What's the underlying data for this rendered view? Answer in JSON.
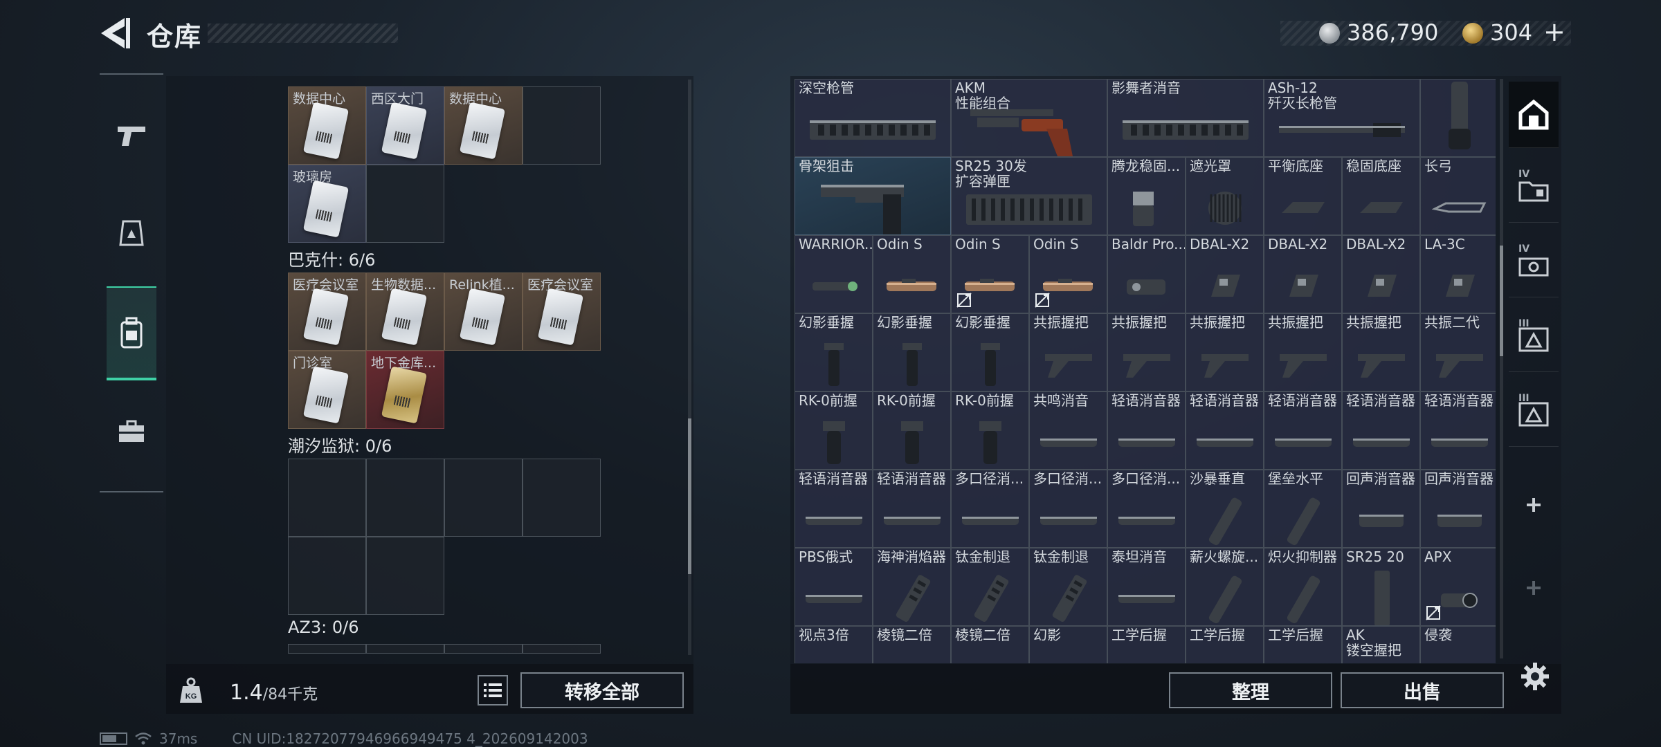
{
  "header": {
    "title": "仓库",
    "currency": {
      "silver": "386,790",
      "gold": "304",
      "gold_plus": "+"
    }
  },
  "left_rail": {
    "items": [
      {
        "icon": "gun-icon",
        "active": false
      },
      {
        "icon": "helmet-icon",
        "active": false
      },
      {
        "icon": "backpack-icon",
        "active": true
      },
      {
        "icon": "briefcase-icon",
        "active": false
      }
    ]
  },
  "containers": {
    "top_group": {
      "cells": [
        {
          "label": "数据中心",
          "filled": true,
          "tone": "warm"
        },
        {
          "label": "西区大门",
          "filled": true,
          "tone": "cool"
        },
        {
          "label": "数据中心",
          "filled": true,
          "tone": "warm"
        },
        {
          "label": "",
          "filled": false
        },
        {
          "label": "玻璃房",
          "filled": true,
          "tone": "cool"
        },
        {
          "label": "",
          "filled": false
        }
      ]
    },
    "baksh": {
      "title": "巴克什: 6/6",
      "cells": [
        {
          "label": "医疗会议室",
          "filled": true,
          "tone": "warm"
        },
        {
          "label": "生物数据...",
          "filled": true,
          "tone": "warm"
        },
        {
          "label": "Relink植...",
          "filled": true,
          "tone": "warm"
        },
        {
          "label": "医疗会议室",
          "filled": true,
          "tone": "warm"
        },
        {
          "label": "门诊室",
          "filled": true,
          "tone": "warm"
        },
        {
          "label": "地下金库...",
          "filled": true,
          "tone": "red",
          "gold": true
        }
      ]
    },
    "tidal_prison": {
      "title": "潮汐监狱: 0/6"
    },
    "az3": {
      "title": "AZ3: 0/6"
    }
  },
  "left_footer": {
    "weight_current": "1.4",
    "weight_max": "/84千克",
    "transfer_all": "转移全部"
  },
  "stash_grid": {
    "rows": [
      [
        {
          "label": "深空枪管",
          "span": 2,
          "icon": "handguard"
        },
        {
          "label": "AKM\n性能组合",
          "span": 2,
          "icon": "akm-parts"
        },
        {
          "label": "影舞者消音",
          "span": 2,
          "icon": "handguard"
        },
        {
          "label": "ASh-12\n歼灭长枪管",
          "span": 2,
          "icon": "long-barrel"
        },
        {
          "label": "",
          "span": 1,
          "icon": "suppressor-vertical",
          "tall": true
        }
      ],
      [
        {
          "label": "骨架狙击",
          "span": 2,
          "icon": "stock",
          "tone": "blue"
        },
        {
          "label": "SR25 30发\n扩容弹匣",
          "span": 2,
          "icon": "magazine"
        },
        {
          "label": "腾龙稳固...",
          "span": 1,
          "icon": "grip-block"
        },
        {
          "label": "遮光罩",
          "span": 1,
          "icon": "hood"
        },
        {
          "label": "平衡底座",
          "span": 1,
          "icon": "mount"
        },
        {
          "label": "稳固底座",
          "span": 1,
          "icon": "mount"
        },
        {
          "label": "长弓",
          "span": 1,
          "icon": "rail"
        }
      ],
      [
        {
          "label": "WARRIOR...",
          "icon": "flashlight"
        },
        {
          "label": "Odin S",
          "icon": "scope-small"
        },
        {
          "label": "Odin S",
          "icon": "scope-small",
          "nodrop": true
        },
        {
          "label": "Odin S",
          "icon": "scope-small",
          "nodrop": true
        },
        {
          "label": "Baldr Pro...",
          "icon": "laser"
        },
        {
          "label": "DBAL-X2",
          "icon": "laser-box"
        },
        {
          "label": "DBAL-X2",
          "icon": "laser-box"
        },
        {
          "label": "DBAL-X2",
          "icon": "laser-box"
        },
        {
          "label": "LA-3C",
          "icon": "laser-box"
        }
      ],
      [
        {
          "label": "幻影垂握",
          "icon": "vertical-grip"
        },
        {
          "label": "幻影垂握",
          "icon": "vertical-grip"
        },
        {
          "label": "幻影垂握",
          "icon": "vertical-grip"
        },
        {
          "label": "共振握把",
          "icon": "angled-grip"
        },
        {
          "label": "共振握把",
          "icon": "angled-grip"
        },
        {
          "label": "共振握把",
          "icon": "angled-grip"
        },
        {
          "label": "共振握把",
          "icon": "angled-grip"
        },
        {
          "label": "共振握把",
          "icon": "angled-grip"
        },
        {
          "label": "共振二代",
          "icon": "angled-grip"
        }
      ],
      [
        {
          "label": "RK-0前握",
          "icon": "foregrip"
        },
        {
          "label": "RK-0前握",
          "icon": "foregrip"
        },
        {
          "label": "RK-0前握",
          "icon": "foregrip"
        },
        {
          "label": "共鸣消音",
          "icon": "suppressor"
        },
        {
          "label": "轻语消音器",
          "icon": "suppressor"
        },
        {
          "label": "轻语消音器",
          "icon": "suppressor"
        },
        {
          "label": "轻语消音器",
          "icon": "suppressor"
        },
        {
          "label": "轻语消音器",
          "icon": "suppressor"
        },
        {
          "label": "轻语消音器",
          "icon": "suppressor"
        }
      ],
      [
        {
          "label": "轻语消音器",
          "icon": "suppressor"
        },
        {
          "label": "轻语消音器",
          "icon": "suppressor"
        },
        {
          "label": "多口径消...",
          "icon": "suppressor"
        },
        {
          "label": "多口径消...",
          "icon": "suppressor"
        },
        {
          "label": "多口径消...",
          "icon": "suppressor"
        },
        {
          "label": "沙暴垂直",
          "icon": "diag-suppressor"
        },
        {
          "label": "堡垒水平",
          "icon": "diag-suppressor"
        },
        {
          "label": "回声消音器",
          "icon": "suppressor-short"
        },
        {
          "label": "回声消音器",
          "icon": "suppressor-short"
        }
      ],
      [
        {
          "label": "PBS俄式",
          "icon": "suppressor"
        },
        {
          "label": "海神消焰器",
          "icon": "brake"
        },
        {
          "label": "钛金制退",
          "icon": "brake"
        },
        {
          "label": "钛金制退",
          "icon": "brake"
        },
        {
          "label": "泰坦消音",
          "icon": "suppressor"
        },
        {
          "label": "薪火螺旋...",
          "icon": "diag-suppressor"
        },
        {
          "label": "炽火抑制器",
          "icon": "diag-suppressor"
        },
        {
          "label": "SR25 20",
          "icon": "magazine-small"
        },
        {
          "label": "APX",
          "icon": "sight",
          "nodrop": true
        }
      ],
      [
        {
          "label": "视点3倍",
          "icon": "none"
        },
        {
          "label": "棱镜二倍",
          "icon": "none"
        },
        {
          "label": "棱镜二倍",
          "icon": "none"
        },
        {
          "label": "幻影",
          "icon": "none"
        },
        {
          "label": "工学后握",
          "icon": "none"
        },
        {
          "label": "工学后握",
          "icon": "none"
        },
        {
          "label": "工学后握",
          "icon": "none"
        },
        {
          "label": "AK\n镂空握把",
          "icon": "none"
        },
        {
          "label": "侵袭",
          "icon": "none"
        }
      ]
    ]
  },
  "right_footer": {
    "sort": "整理",
    "sell": "出售"
  },
  "right_tabs": [
    {
      "icon": "home-shield-icon",
      "roman": "",
      "active": true
    },
    {
      "icon": "folder-iv-icon",
      "roman": "IV",
      "active": false
    },
    {
      "icon": "case-iv-icon",
      "roman": "IV",
      "active": false
    },
    {
      "icon": "triangle-iii-icon",
      "roman": "III",
      "active": false
    },
    {
      "icon": "triangle-iii-icon",
      "roman": "III",
      "active": false
    },
    {
      "icon": "plus-icon",
      "roman": "",
      "active": false,
      "plus": true
    },
    {
      "icon": "plus-icon",
      "roman": "",
      "active": false,
      "plus": true,
      "dim": true
    }
  ],
  "status": {
    "ping": "37ms",
    "uid": "CN UID:18272077946966949475 4_202609142003"
  }
}
